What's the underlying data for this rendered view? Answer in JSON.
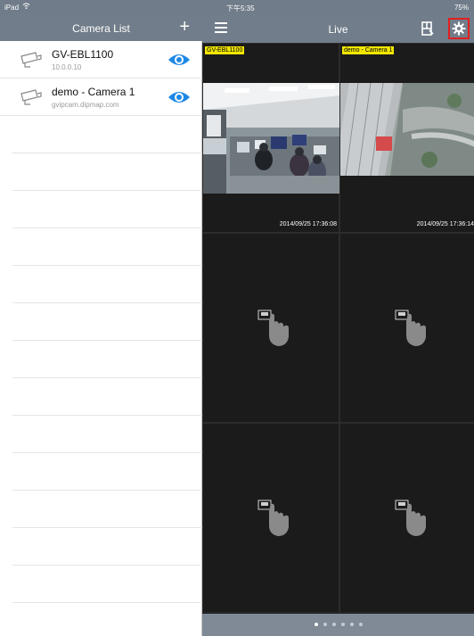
{
  "statusbar": {
    "device": "iPad",
    "time": "下午5:35",
    "battery": "75%"
  },
  "left_panel": {
    "title": "Camera List",
    "add_label": "+",
    "cameras": [
      {
        "name": "GV-EBL1100",
        "address": "10.0.0.10"
      },
      {
        "name": "demo - Camera 1",
        "address": "gvipcam.dipmap.com"
      }
    ]
  },
  "right_panel": {
    "title": "Live",
    "channels": [
      {
        "label": "GV-EBL1100",
        "timestamp": "2014/09/25 17:36:08"
      },
      {
        "label": "demo - Camera 1",
        "timestamp": "2014/09/25 17:36:14"
      }
    ],
    "pages": 6,
    "current_page": 1
  },
  "colors": {
    "header": "#717d8a",
    "eye": "#1e88e5",
    "label_bg": "#f2e600",
    "highlight": "#e02020"
  },
  "icons": [
    "wifi-icon",
    "add-icon",
    "camera-icon",
    "eye-icon",
    "menu-icon",
    "layout-icon",
    "settings-icon",
    "tap-gesture-icon"
  ]
}
